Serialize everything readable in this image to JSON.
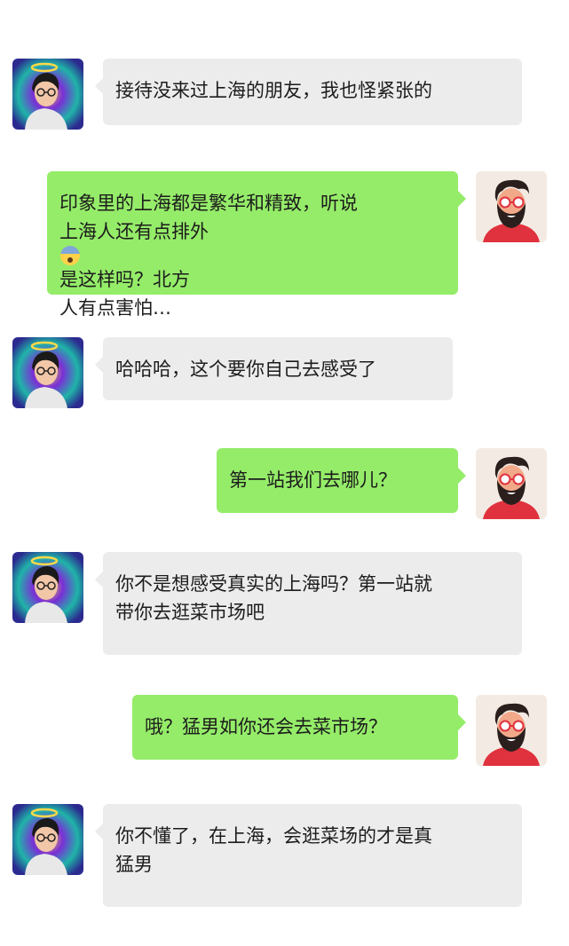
{
  "messages": [
    {
      "side": "left",
      "lines": [
        "接待没来过上海的朋友，我也怪紧张的"
      ]
    },
    {
      "side": "right",
      "lines": [
        "印象里的上海都是繁华和精致，听说",
        "上海人还有点排外{emoji}是这样吗？北方",
        "人有点害怕…"
      ],
      "emoji": "fearful-face-emoji"
    },
    {
      "side": "left",
      "lines": [
        "哈哈哈，这个要你自己去感受了"
      ]
    },
    {
      "side": "right",
      "lines": [
        "第一站我们去哪儿？"
      ]
    },
    {
      "side": "left",
      "lines": [
        "你不是想感受真实的上海吗？第一站就",
        "带你去逛菜市场吧"
      ]
    },
    {
      "side": "right",
      "lines": [
        "哦？猛男如你还会去菜市场？"
      ]
    },
    {
      "side": "left",
      "lines": [
        "你不懂了，在上海，会逛菜场的才是真",
        "猛男"
      ]
    }
  ],
  "avatars": {
    "left": "anime-boy-with-halo-avatar",
    "right": "bearded-man-with-glasses-avatar"
  },
  "colors": {
    "received_bubble": "#ececec",
    "sent_bubble": "#95ec69",
    "background": "#ffffff"
  }
}
